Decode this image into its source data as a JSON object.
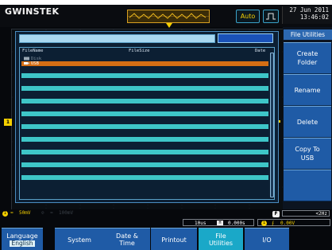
{
  "brand": {
    "logo": "GWINSTEK"
  },
  "top": {
    "mode_button": "Auto",
    "date": "27 Jun 2011",
    "time": "13:46:02"
  },
  "file_dialog": {
    "columns": {
      "name": "FileName",
      "size": "FileSize",
      "date": "Date"
    },
    "rows": [
      {
        "name": "Disk",
        "state": "normal"
      },
      {
        "name": "USB",
        "state": "selected"
      }
    ]
  },
  "side_menu": {
    "title": "File Utilities",
    "buttons": [
      "Create Folder",
      "Rename",
      "Delete",
      "Copy To USB"
    ]
  },
  "status": {
    "ch1_scale": "50mV",
    "ch2_scale": "100mV",
    "time_div": "10us",
    "h_pos": "0.000s",
    "trig_level": "0.00V",
    "freq": "<2Hz"
  },
  "bottom_menu": {
    "items": [
      {
        "label": "Language",
        "sub": "English"
      },
      {
        "label": "System"
      },
      {
        "label": "Date & Time"
      },
      {
        "label": "Printout"
      },
      {
        "label": "File Utilities"
      },
      {
        "label": "I/O"
      }
    ]
  },
  "colors": {
    "accent": "#1f5ba6",
    "selected_row": "#d46e14",
    "row_fill": "#3ec6c8",
    "channel1": "#f5d000"
  }
}
